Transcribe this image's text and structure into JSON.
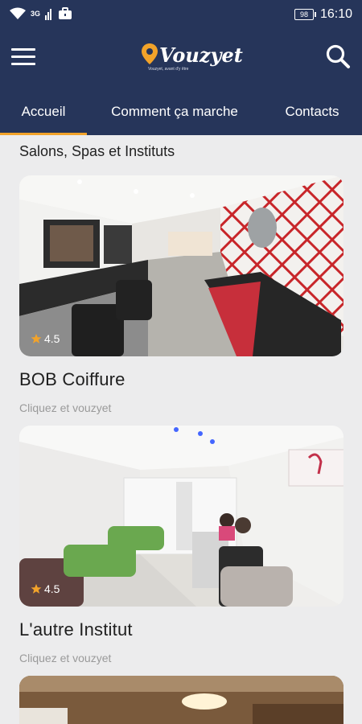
{
  "status": {
    "network": "3G",
    "battery": "98",
    "time": "16:10"
  },
  "header": {
    "brand": "Vouzyet",
    "tagline": "Vouzyet, avant d'y être",
    "tabs": [
      {
        "label": "Accueil",
        "active": true
      },
      {
        "label": "Comment ça marche",
        "active": false
      },
      {
        "label": "Contacts",
        "active": false
      }
    ],
    "accent_color": "#f2a32a",
    "bar_color": "#26355a"
  },
  "main": {
    "section_title": "Salons, Spas et Instituts",
    "listings": [
      {
        "name": "BOB Coiffure",
        "subtitle": "Cliquez et vouzyet",
        "rating": "4.5"
      },
      {
        "name": "L'autre Institut",
        "subtitle": "Cliquez et vouzyet",
        "rating": "4.5"
      }
    ]
  }
}
